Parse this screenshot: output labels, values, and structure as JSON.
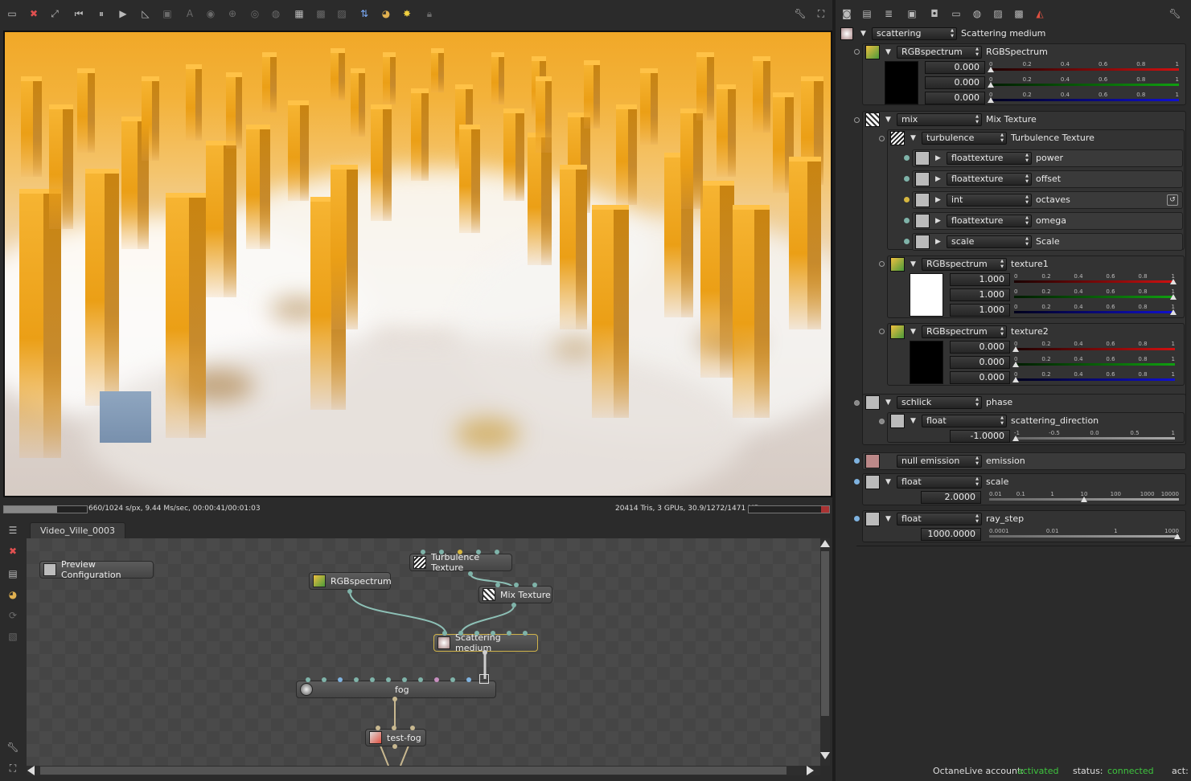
{
  "viewport_toolbar": {
    "icons": [
      "save-render-icon",
      "clear-render-icon",
      "fit-view-icon",
      "restart-render-icon",
      "pause-render-icon",
      "start-render-icon",
      "focus-picker-icon",
      "viewport-resolution-icon",
      "white-balance-icon",
      "material-picker-icon",
      "object-picker-icon",
      "camera-target-icon",
      "world-icon",
      "lock-viewport-icon",
      "region-render-icon",
      "film-region-icon",
      "decal-icon",
      "layer-icon",
      "color-picker-icon",
      "sun-icon",
      "lock-icon"
    ]
  },
  "status": {
    "left": "660/1024 s/px, 9.44 Ms/sec, 00:00:41/00:01:03",
    "right": "20414 Tris, 3 GPUs, 30.9/1272/1471 MB",
    "progress": 0.645
  },
  "graph": {
    "tab": "Video_Ville_0003",
    "nodes": {
      "preview": "Preview Configuration",
      "rgb": "RGBspectrum",
      "turbulence": "Turbulence Texture",
      "mix": "Mix Texture",
      "scattering": "Scattering medium",
      "fog": "fog",
      "testfog": "test-fog"
    }
  },
  "panel": {
    "root": {
      "combo": "scattering",
      "label": "Scattering medium"
    },
    "absorption": {
      "combo": "RGBspectrum",
      "label": "RGBSpectrum",
      "values": [
        "0.000",
        "0.000",
        "0.000"
      ],
      "swatch": "#000000"
    },
    "mix": {
      "combo": "mix",
      "label": "Mix Texture"
    },
    "turbulence": {
      "combo": "turbulence",
      "label": "Turbulence Texture"
    },
    "turb_params": [
      {
        "combo": "floattexture",
        "label": "power"
      },
      {
        "combo": "floattexture",
        "label": "offset"
      },
      {
        "combo": "int",
        "label": "octaves"
      },
      {
        "combo": "floattexture",
        "label": "omega"
      },
      {
        "combo": "scale",
        "label": "Scale"
      }
    ],
    "texture1": {
      "combo": "RGBspectrum",
      "label": "texture1",
      "values": [
        "1.000",
        "1.000",
        "1.000"
      ],
      "swatch": "#ffffff"
    },
    "texture2": {
      "combo": "RGBspectrum",
      "label": "texture2",
      "values": [
        "0.000",
        "0.000",
        "0.000"
      ],
      "swatch": "#000000"
    },
    "phase": {
      "combo": "schlick",
      "label": "phase"
    },
    "scattering_direction": {
      "combo": "float",
      "label": "scattering_direction",
      "value": "-1.0000"
    },
    "emission": {
      "combo": "null emission",
      "label": "emission"
    },
    "scale": {
      "combo": "float",
      "label": "scale",
      "value": "2.0000"
    },
    "ray_step": {
      "combo": "float",
      "label": "ray_step",
      "value": "1000.0000"
    },
    "rgb_scale": [
      "0",
      "0.2",
      "0.4",
      "0.6",
      "0.8",
      "1"
    ],
    "dir_scale": [
      "-1",
      "-0.5",
      "0.0",
      "0.5",
      "1"
    ],
    "scale_scale": [
      "0.01",
      "0.1",
      "1",
      "10",
      "100",
      "1000",
      "10000"
    ],
    "ray_scale": [
      "0.0001",
      "0.01",
      "1",
      "1000"
    ]
  },
  "footer": {
    "account_label": "OctaneLive account:",
    "account_value": "activated",
    "status_label": "status:",
    "status_value": "connected",
    "act_label": "act:"
  },
  "colors": {
    "accent_green": "#3ec43e",
    "red_bar": "#d01010",
    "green_bar": "#10a010",
    "blue_bar": "#1010d0"
  }
}
